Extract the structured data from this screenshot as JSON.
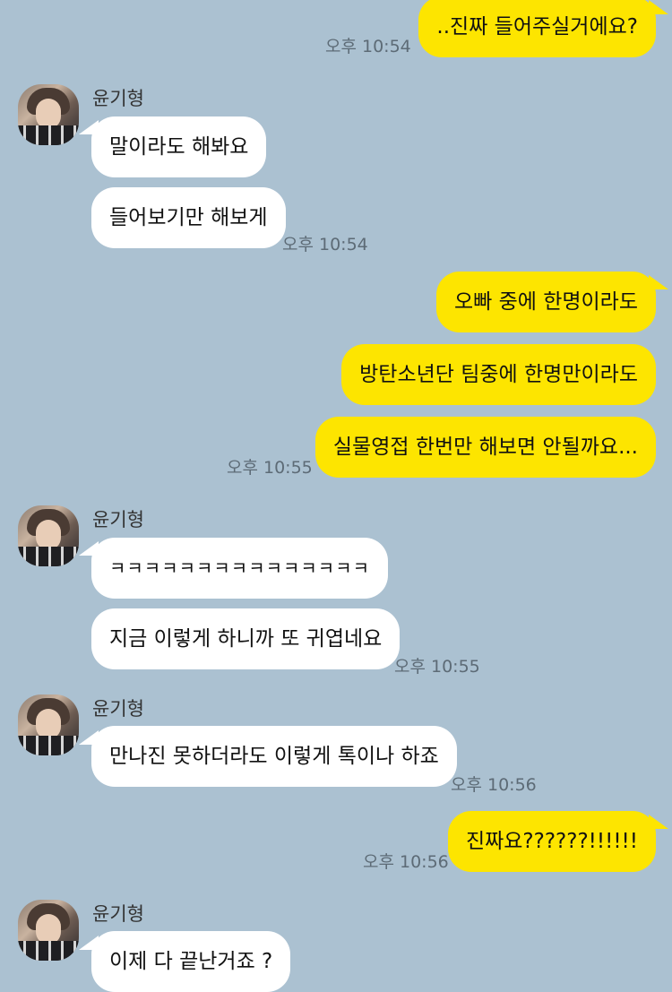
{
  "contact_name": "윤기형",
  "messages": [
    {
      "sender": "me",
      "text": "..진짜 들어주실거에요?"
    },
    {
      "sender": "them",
      "text": "말이라도 해봐요"
    },
    {
      "sender": "them",
      "text": "들어보기만 해보게"
    },
    {
      "sender": "me",
      "text": "오빠 중에 한명이라도"
    },
    {
      "sender": "me",
      "text": "방탄소년단 팀중에 한명만이라도"
    },
    {
      "sender": "me",
      "text": "실물영접 한번만 해보면 안될까요..."
    },
    {
      "sender": "them",
      "text": "ㅋㅋㅋㅋㅋㅋㅋㅋㅋㅋㅋㅋㅋㅋㅋ"
    },
    {
      "sender": "them",
      "text": "지금 이렇게 하니까 또 귀엽네요"
    },
    {
      "sender": "them",
      "text": "만나진 못하더라도 이렇게 톡이나 하죠"
    },
    {
      "sender": "me",
      "text": "진짜요??????!!!!!!"
    },
    {
      "sender": "them",
      "text": "이제 다 끝난거죠 ?"
    }
  ],
  "timestamps": [
    "오후 10:54",
    "오후 10:54",
    "오후 10:55",
    "오후 10:55",
    "오후 10:56",
    "오후 10:56"
  ]
}
